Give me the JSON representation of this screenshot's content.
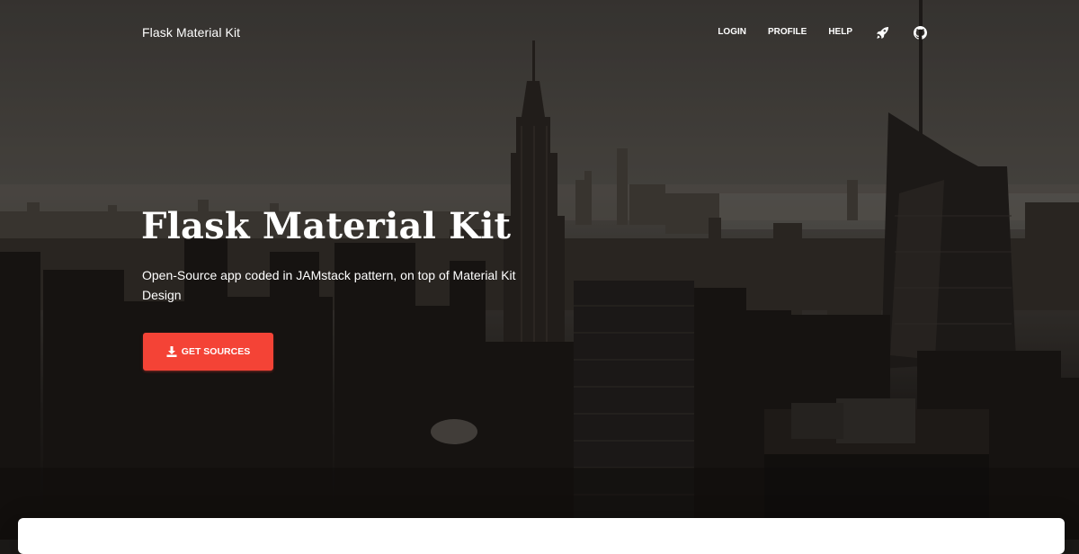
{
  "navbar": {
    "brand": "Flask Material Kit",
    "links": [
      {
        "label": "LOGIN"
      },
      {
        "label": "PROFILE"
      },
      {
        "label": "HELP"
      }
    ],
    "icons": [
      "rocket-icon",
      "github-icon"
    ]
  },
  "hero": {
    "title": "Flask Material Kit",
    "subtitle": "Open-Source app coded in JAMstack pattern, on top of Material Kit Design",
    "cta": {
      "label": "GET SOURCES",
      "icon": "download-icon"
    }
  },
  "colors": {
    "accent": "#f44336",
    "text": "#ffffff",
    "card": "#ffffff"
  }
}
